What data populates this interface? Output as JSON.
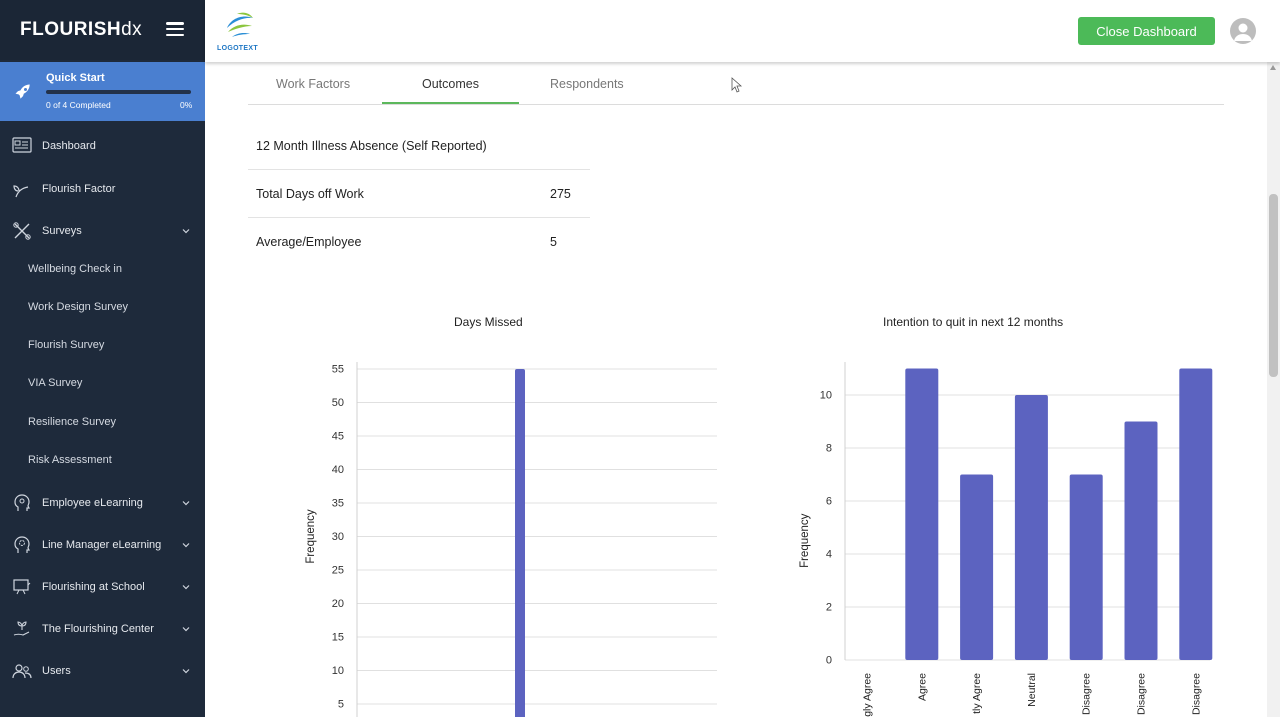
{
  "brand": {
    "name_bold": "FLOURISH",
    "name_light": "dx"
  },
  "quick_start": {
    "title": "Quick Start",
    "progress_text": "0 of 4 Completed",
    "percent_text": "0%",
    "progress_fraction": 0
  },
  "sidebar": {
    "items": [
      {
        "label": "Dashboard",
        "icon": "dashboard-icon"
      },
      {
        "label": "Flourish Factor",
        "icon": "plant-icon"
      },
      {
        "label": "Surveys",
        "icon": "tools-icon"
      },
      {
        "label": "Employee eLearning",
        "icon": "head-icon"
      },
      {
        "label": "Line Manager eLearning",
        "icon": "head-gear-icon"
      },
      {
        "label": "Flourishing at School",
        "icon": "school-icon"
      },
      {
        "label": "The Flourishing Center",
        "icon": "hand-plant-icon"
      },
      {
        "label": "Users",
        "icon": "users-icon"
      }
    ],
    "survey_subitems": [
      "Wellbeing Check in",
      "Work Design Survey",
      "Flourish Survey",
      "VIA Survey",
      "Resilience Survey",
      "Risk Assessment"
    ]
  },
  "header": {
    "logo_text": "LOGOTEXT",
    "close_label": "Close Dashboard"
  },
  "tabs": [
    "Work Factors",
    "Outcomes",
    "Respondents"
  ],
  "active_tab": "Outcomes",
  "absence": {
    "heading": "12 Month Illness Absence (Self Reported)",
    "rows": [
      {
        "label": "Total Days off Work",
        "value": "275"
      },
      {
        "label": "Average/Employee",
        "value": "5"
      }
    ]
  },
  "chart_data": [
    {
      "type": "bar",
      "title": "Days Missed",
      "xlabel": "",
      "ylabel": "Frequency",
      "categories": [
        ""
      ],
      "values": [
        55
      ],
      "yticks": [
        5,
        10,
        15,
        20,
        25,
        30,
        35,
        40,
        45,
        50,
        55
      ],
      "ylim": [
        0,
        55
      ],
      "grid": true,
      "color": "#5c63c0"
    },
    {
      "type": "bar",
      "title": "Intention to quit in next 12 months",
      "xlabel": "",
      "ylabel": "Frequency",
      "categories": [
        "gly Agree",
        "Agree",
        "tly Agree",
        "Neutral",
        "Disagree",
        "Disagree",
        "Disagree"
      ],
      "values": [
        0,
        11,
        7,
        10,
        7,
        9,
        11
      ],
      "yticks": [
        0,
        2,
        4,
        6,
        8,
        10
      ],
      "ylim": [
        0,
        11
      ],
      "grid": true,
      "color": "#5c63c0"
    }
  ]
}
